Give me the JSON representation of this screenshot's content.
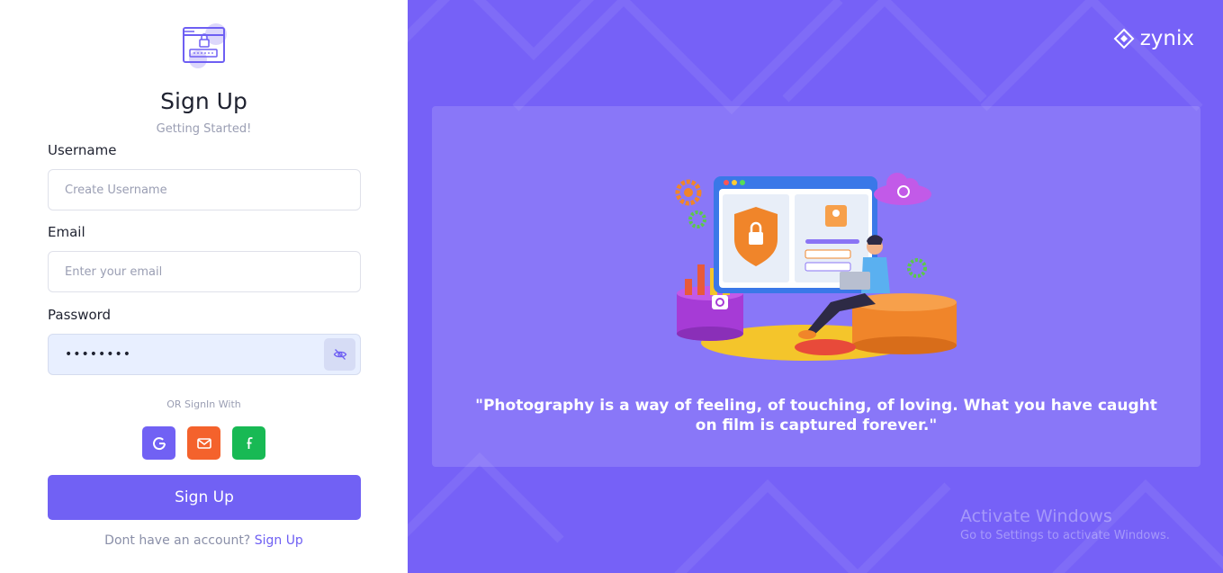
{
  "form": {
    "title": "Sign Up",
    "subtitle": "Getting Started!",
    "username_label": "Username",
    "username_placeholder": "Create Username",
    "email_label": "Email",
    "email_placeholder": "Enter your email",
    "password_label": "Password",
    "password_value": "••••••••",
    "or_text": "OR SignIn With",
    "social": [
      {
        "name": "google",
        "icon": "google-icon",
        "color": "#7161f4"
      },
      {
        "name": "mail",
        "icon": "mail-icon",
        "color": "#f4622c"
      },
      {
        "name": "facebook",
        "icon": "facebook-icon",
        "color": "#18b954"
      }
    ],
    "submit_label": "Sign Up",
    "account_text": "Dont have an account?",
    "account_link": "Sign Up"
  },
  "brand": {
    "name": "zynix"
  },
  "hero": {
    "quote": "\"Photography is a way of feeling, of touching, of loving. What you have caught on film is captured forever.\""
  },
  "watermark": {
    "line1": "Activate Windows",
    "line2": "Go to Settings to activate Windows."
  },
  "colors": {
    "accent": "#7161f4",
    "panel": "#7661f7",
    "mail": "#f4622c",
    "facebook": "#18b954"
  }
}
